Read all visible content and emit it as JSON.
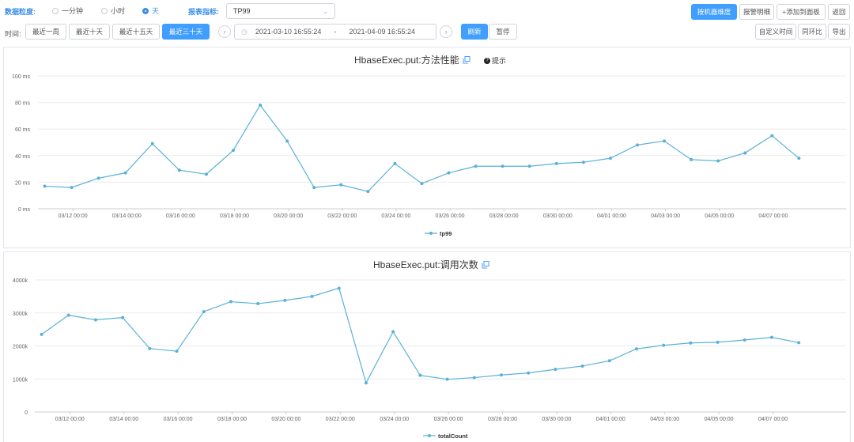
{
  "toolbar": {
    "granularity_label": "数据粒度:",
    "granularity_options": [
      {
        "label": "一分钟",
        "selected": false
      },
      {
        "label": "小时",
        "selected": false
      },
      {
        "label": "天",
        "selected": true
      }
    ],
    "metric_label": "报表指标:",
    "metric_value": "TP99",
    "right_buttons": [
      "按机器维度",
      "报警明细",
      "+添加到面板",
      "返回"
    ]
  },
  "timebar": {
    "label": "时间:",
    "ranges": [
      {
        "label": "最近一周",
        "active": false
      },
      {
        "label": "最近十天",
        "active": false
      },
      {
        "label": "最近十五天",
        "active": false
      },
      {
        "label": "最近三十天",
        "active": true
      }
    ],
    "start": "2021-03-10 16:55:24",
    "separator": "-",
    "end": "2021-04-09 16:55:24",
    "refresh_label": "刷新",
    "pause_label": "暂停",
    "right_buttons": [
      "自定义时间",
      "同环比",
      "导出"
    ]
  },
  "charts": {
    "tp99": {
      "title": "HbaseExec.put:方法性能",
      "hint_label": "提示"
    },
    "count": {
      "title": "HbaseExec.put:调用次数"
    }
  },
  "colors": {
    "accent": "#409eff",
    "series": "#5ab1d8"
  },
  "chart_data": [
    {
      "type": "line",
      "title": "HbaseExec.put:方法性能",
      "x_ticks": [
        "03/12 00:00",
        "03/14 00:00",
        "03/16 00:00",
        "03/18 00:00",
        "03/20 00:00",
        "03/22 00:00",
        "03/24 00:00",
        "03/26 00:00",
        "03/28 00:00",
        "03/30 00:00",
        "04/01 00:00",
        "04/03 00:00",
        "04/05 00:00",
        "04/07 00:00"
      ],
      "y_ticks": [
        "0 ms",
        "20 ms",
        "40 ms",
        "60 ms",
        "80 ms",
        "100 ms"
      ],
      "ylim": [
        0,
        100
      ],
      "series": [
        {
          "name": "tp99",
          "values": [
            17,
            16,
            23,
            27,
            49,
            29,
            26,
            44,
            78,
            51,
            16,
            18,
            13,
            34,
            19,
            27,
            32,
            32,
            32,
            34,
            35,
            38,
            48,
            51,
            37,
            36,
            42,
            55,
            38
          ]
        }
      ],
      "legend": "bottom-center",
      "grid": true
    },
    {
      "type": "line",
      "title": "HbaseExec.put:调用次数",
      "x_ticks": [
        "03/12 00:00",
        "03/14 00:00",
        "03/16 00:00",
        "03/18 00:00",
        "03/20 00:00",
        "03/22 00:00",
        "03/24 00:00",
        "03/26 00:00",
        "03/28 00:00",
        "03/30 00:00",
        "04/01 00:00",
        "04/03 00:00",
        "04/05 00:00",
        "04/07 00:00"
      ],
      "y_ticks": [
        "0",
        "1000k",
        "2000k",
        "3000k",
        "4000k"
      ],
      "ylim": [
        0,
        4000000
      ],
      "series": [
        {
          "name": "totalCount",
          "values": [
            2350000,
            2930000,
            2790000,
            2860000,
            1920000,
            1840000,
            3040000,
            3340000,
            3280000,
            3380000,
            3500000,
            3750000,
            880000,
            2430000,
            1110000,
            990000,
            1040000,
            1120000,
            1180000,
            1290000,
            1390000,
            1550000,
            1910000,
            2020000,
            2090000,
            2110000,
            2180000,
            2260000,
            2100000
          ]
        }
      ],
      "legend": "bottom-center",
      "grid": true
    }
  ]
}
